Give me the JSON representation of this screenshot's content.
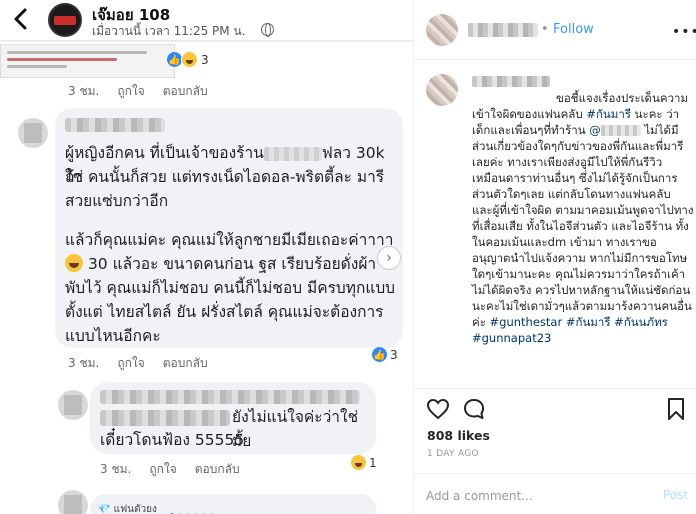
{
  "facebook": {
    "page_name": "เจ๊มอย 108",
    "post_time": "เมื่อวานนี้ เวลา 11:25 PM น.",
    "quote": {
      "reaction_count": "3",
      "actions": {
        "time": "3 ชม.",
        "like": "ถูกใจ",
        "reply": "ตอบกลับ"
      }
    },
    "comment1": {
      "line1_a": "ผู้หญิงอีกคน ที่เป็นเจ้าของร้าน",
      "line1_b": "ฟลว 30k ถ้า",
      "line2": "ใช่ คนนั้นก็สวย แต่ทรงเน็ดไอดอล-พริตตี้ละ มารี",
      "line3": "สวยแซ่บกว่าอีก",
      "line4": "แล้วก็คุณแม่คะ คุณแม่ให้ลูกชายมีเมียเถอะค่าาาา",
      "line5": "30 แล้วอะ ขนาดคนก่อน ฐส เรียบร้อยดั่งผ้า",
      "line6": "พับไว้ คุณแม่ก็ไม่ชอบ คนนี้ก็ไม่ชอบ มีครบทุกแบบ",
      "line7": "ตั้งแต่ ไทยสไตล์ ยัน ฝรั่งสไตล์ คุณแม่จะต้องการ",
      "line8": "แบบไหนอีกคะ",
      "reaction_count": "3",
      "actions": {
        "time": "3 ชม.",
        "like": "ถูกใจ",
        "reply": "ตอบกลับ"
      }
    },
    "comment2": {
      "line1": "ยังไม่แน่ใจค่ะว่าใช่มั้ย",
      "line2": "เดี๋ยวโดนฟ้อง 55555",
      "reaction_count": "1",
      "actions": {
        "time": "3 ชม.",
        "like": "ถูกใจ",
        "reply": "ตอบกลับ"
      }
    },
    "fan_badge": "แฟนตัวยง"
  },
  "instagram": {
    "follow_label": "Follow",
    "separator": "•",
    "caption": {
      "p1": "ขอชี้แจงเรื่องประเด็นความเข้าใจผิดของแฟนคลับ",
      "tag1": "#กันมารี",
      "p2": "นะคะ ว่าเด็กและเพื่อนๆที่ทำร้าน",
      "mention": "@",
      "p3": "ไม่ได้มีส่วนเกี่ยวข้องใดๆกับข่าวของพี่กันและพี่มารีเลยค่ะ ทางเราเพียงส่งอูมีไปให้พี่กันรีวิว เหมือนดาราท่านอื่นๆ ซึ่งไม่ได้รู้จักเป็นการส่วนตัวใดๆเลย แต่กลับโดนทางแฟนคลับ และผู้ที่เข้าใจผิด ตามมาคอมเม้นพูดจาไปทางที่เสื่อมเสีย ทั้งในไอจีส่วนตัว และไอจีร้าน ทั้งในคอมเม้นและdm เข้ามา ทางเราขออนุญาตนำไปแจ้งความ หากไม่มีการขอโทษใดๆเข้ามานะคะ คุณไม่ควรมาว่าใครถ้าเค้าไม่ได้ผิดจริง ควรไปหาหลักฐานให้แน่ชัดก่อนนะคะไม่ใช่เดามั่วๆแล้วตามมาร้งควานคนอื่นค่ะ",
      "tags": "#gunthestar #กันมารี #กันนภัทร #gunnapat23"
    },
    "likes": "808 likes",
    "time_ago": "1 DAY AGO",
    "comment_placeholder": "Add a comment...",
    "post_label": "Post",
    "colors": {
      "link": "#3897f0",
      "hashtag": "#003569",
      "post_disabled": "#b2dffc"
    }
  }
}
